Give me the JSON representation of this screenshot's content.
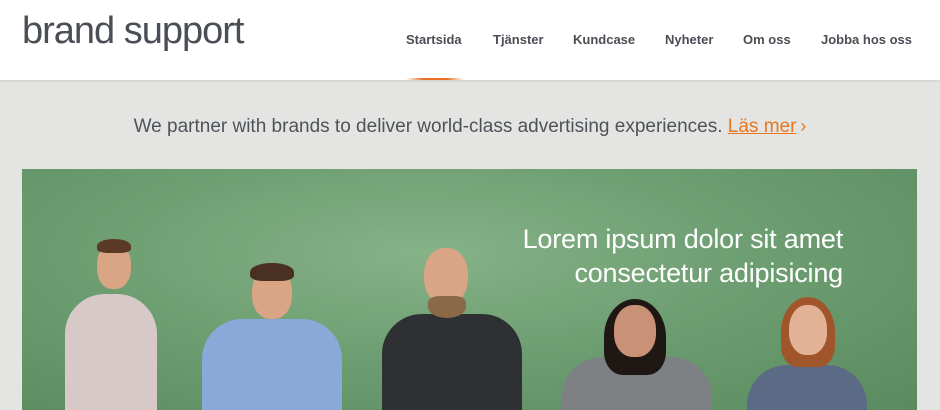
{
  "header": {
    "logo": "brand support",
    "nav": [
      {
        "label": "Startsida",
        "active": true
      },
      {
        "label": "Tjänster"
      },
      {
        "label": "Kundcase"
      },
      {
        "label": "Nyheter"
      },
      {
        "label": "Om oss"
      },
      {
        "label": "Jobba hos oss"
      }
    ]
  },
  "tagline": {
    "text": "We partner with brands to deliver world-class advertising experiences.",
    "link": "Läs mer",
    "chevron": "›"
  },
  "hero": {
    "line1": "Lorem ipsum dolor sit amet",
    "line2": "consectetur adipisicing"
  },
  "colors": {
    "accent": "#e8761f",
    "text": "#4a4e55",
    "hero_green": "#6e9f72"
  }
}
